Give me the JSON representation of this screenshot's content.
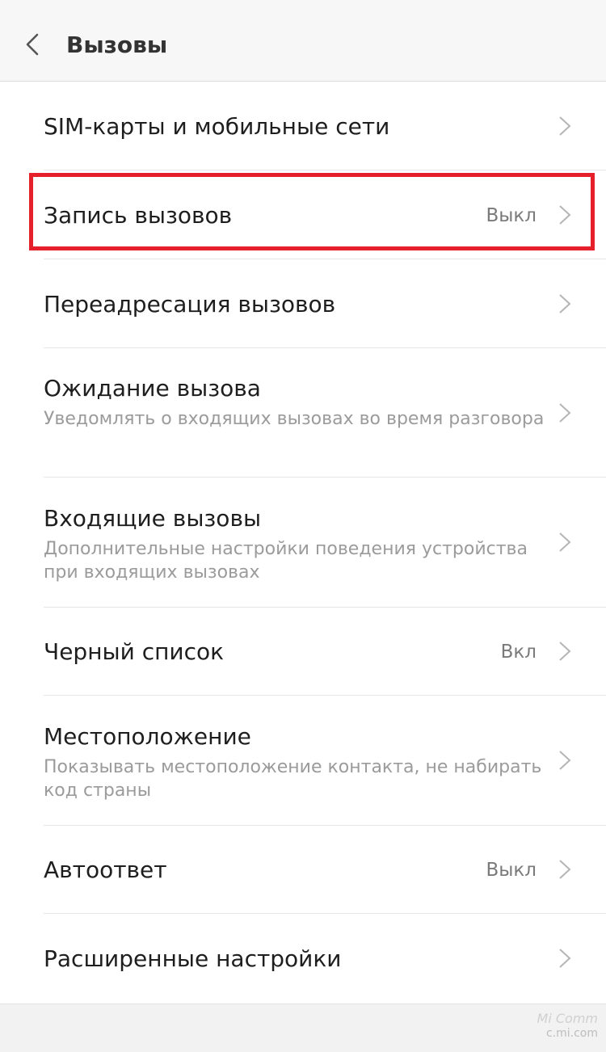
{
  "header": {
    "title": "Вызовы",
    "back_icon": "chevron-left-icon"
  },
  "items": [
    {
      "label": "SIM-карты и мобильные сети",
      "description": "",
      "value": ""
    },
    {
      "label": "Запись вызовов",
      "description": "",
      "value": "Выкл"
    },
    {
      "label": "Переадресация вызовов",
      "description": "",
      "value": ""
    },
    {
      "label": "Ожидание вызова",
      "description": "Уведомлять о входящих вызовах во время разговора",
      "value": ""
    },
    {
      "label": "Входящие вызовы",
      "description": "Дополнительные настройки поведения устройства при входящих вызовах",
      "value": ""
    },
    {
      "label": "Черный список",
      "description": "",
      "value": "Вкл"
    },
    {
      "label": "Местоположение",
      "description": "Показывать местоположение контакта, не набирать код страны",
      "value": ""
    },
    {
      "label": "Автоответ",
      "description": "",
      "value": "Выкл"
    },
    {
      "label": "Расширенные настройки",
      "description": "",
      "value": ""
    }
  ],
  "highlight_color": "#e5202b",
  "watermark": {
    "brand": "Mi Comm",
    "site": "c.mi.com"
  }
}
